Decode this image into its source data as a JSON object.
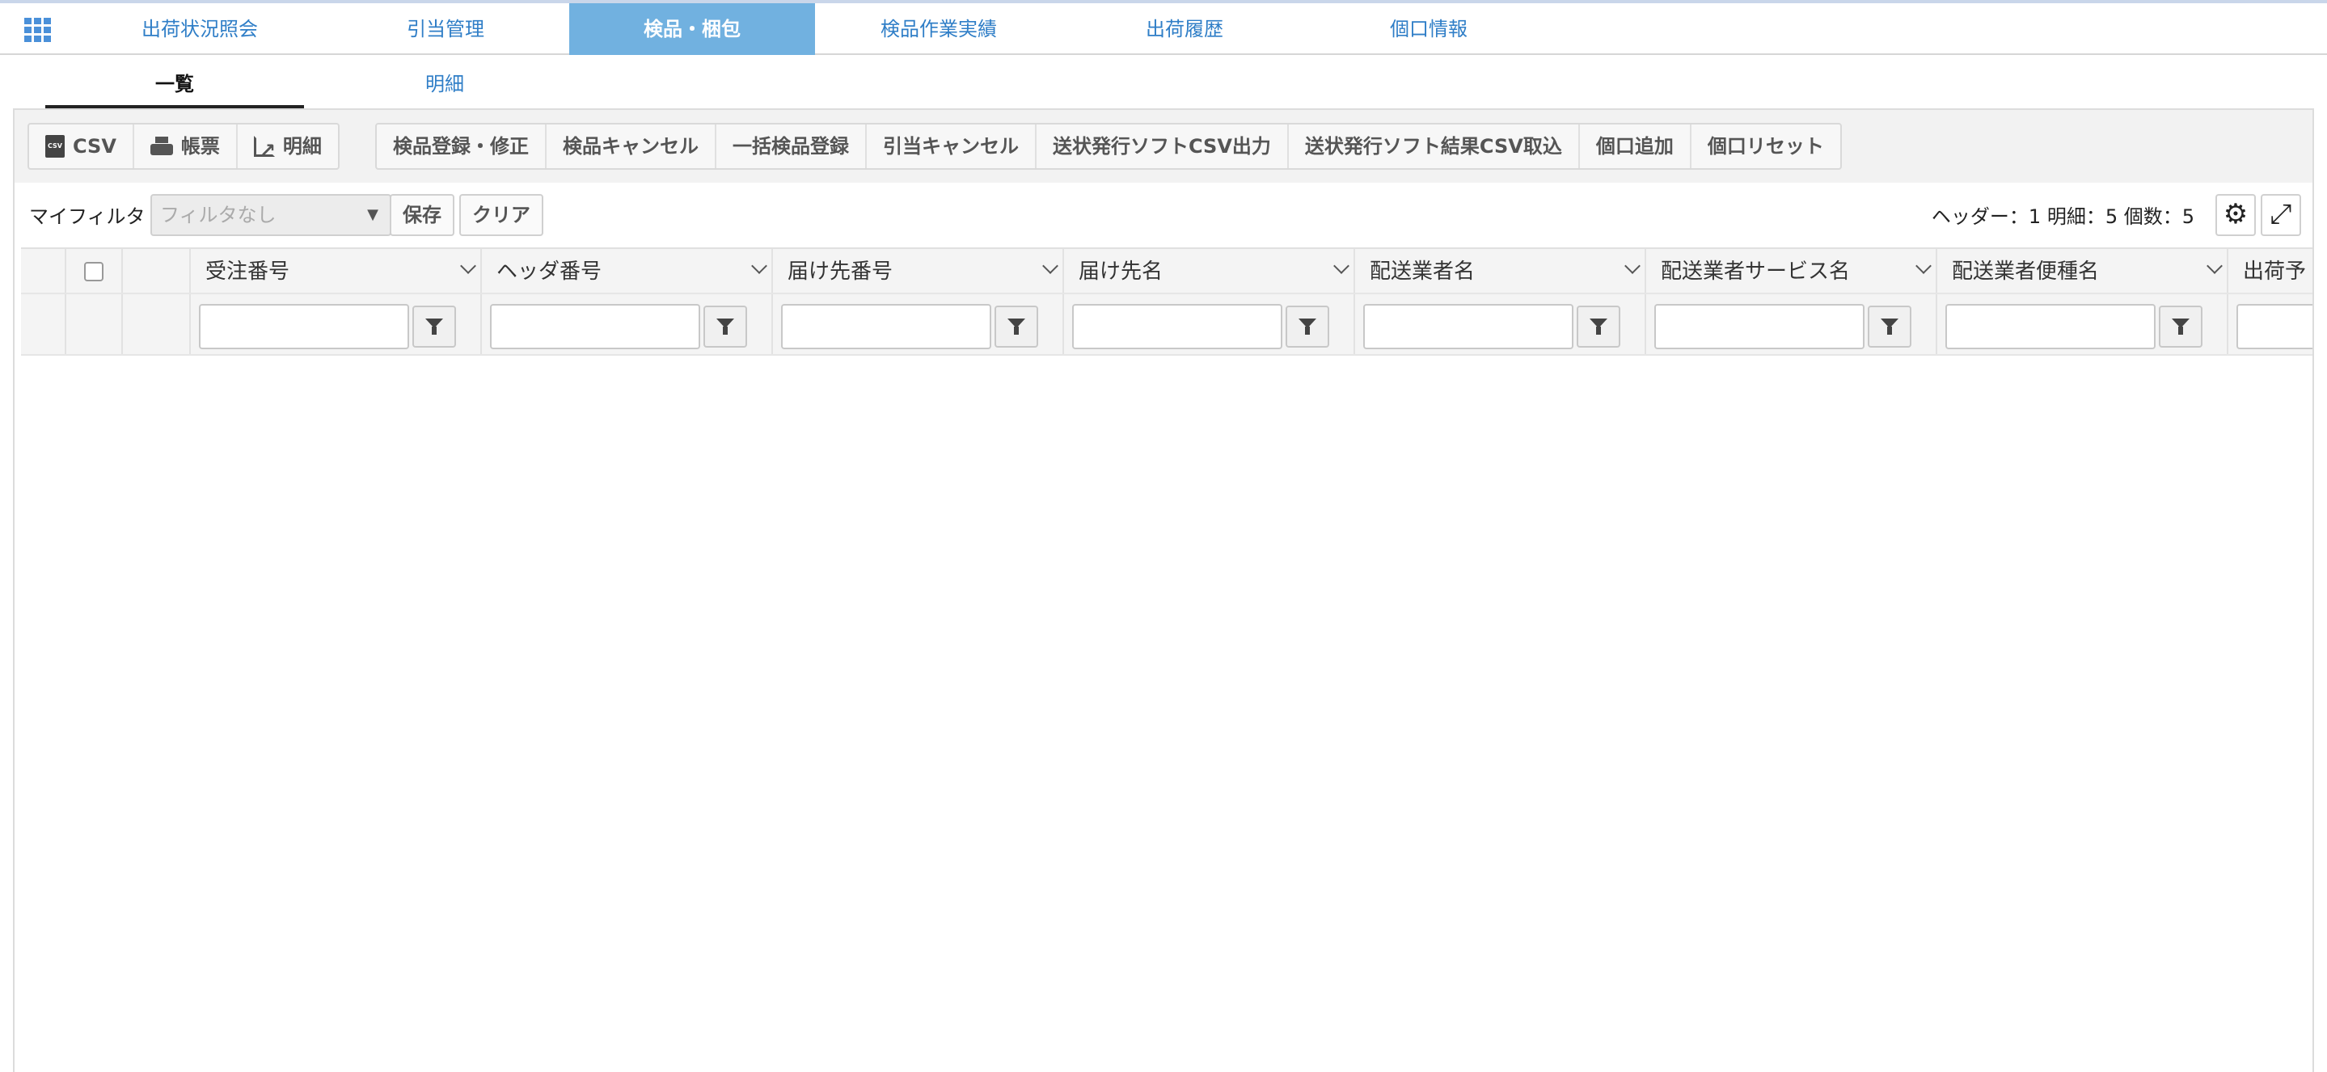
{
  "nav": {
    "tabs": [
      {
        "label": "出荷状況照会"
      },
      {
        "label": "引当管理"
      },
      {
        "label": "検品・梱包"
      },
      {
        "label": "検品作業実績"
      },
      {
        "label": "出荷履歴"
      },
      {
        "label": "個口情報"
      }
    ],
    "active_tab": "検品・梱包"
  },
  "subtabs": [
    {
      "label": "一覧"
    },
    {
      "label": "明細"
    }
  ],
  "toolbar": {
    "group1": [
      {
        "label": "CSV",
        "icon": "csv-file-icon"
      },
      {
        "label": "帳票",
        "icon": "print-icon"
      },
      {
        "label": "明細",
        "icon": "external-link-icon"
      }
    ],
    "group2": [
      {
        "label": "検品登録・修正"
      },
      {
        "label": "検品キャンセル"
      },
      {
        "label": "一括検品登録"
      },
      {
        "label": "引当キャンセル"
      },
      {
        "label": "送状発行ソフトCSV出力"
      },
      {
        "label": "送状発行ソフト結果CSV取込"
      },
      {
        "label": "個口追加"
      },
      {
        "label": "個口リセット"
      }
    ]
  },
  "filter": {
    "label": "マイフィルタ",
    "placeholder": "フィルタなし",
    "save_label": "保存",
    "clear_label": "クリア",
    "counts_text": "ヘッダー：1 明細：5 個数：5"
  },
  "table": {
    "columns": [
      {
        "label": "受注番号"
      },
      {
        "label": "ヘッダ番号"
      },
      {
        "label": "届け先番号"
      },
      {
        "label": "届け先名"
      },
      {
        "label": "配送業者名"
      },
      {
        "label": "配送業者サービス名"
      },
      {
        "label": "配送業者便種名"
      },
      {
        "label": "出荷予"
      }
    ]
  },
  "colors": {
    "accent": "#2f7ec7",
    "active_tab_bg": "#71b1e0"
  }
}
